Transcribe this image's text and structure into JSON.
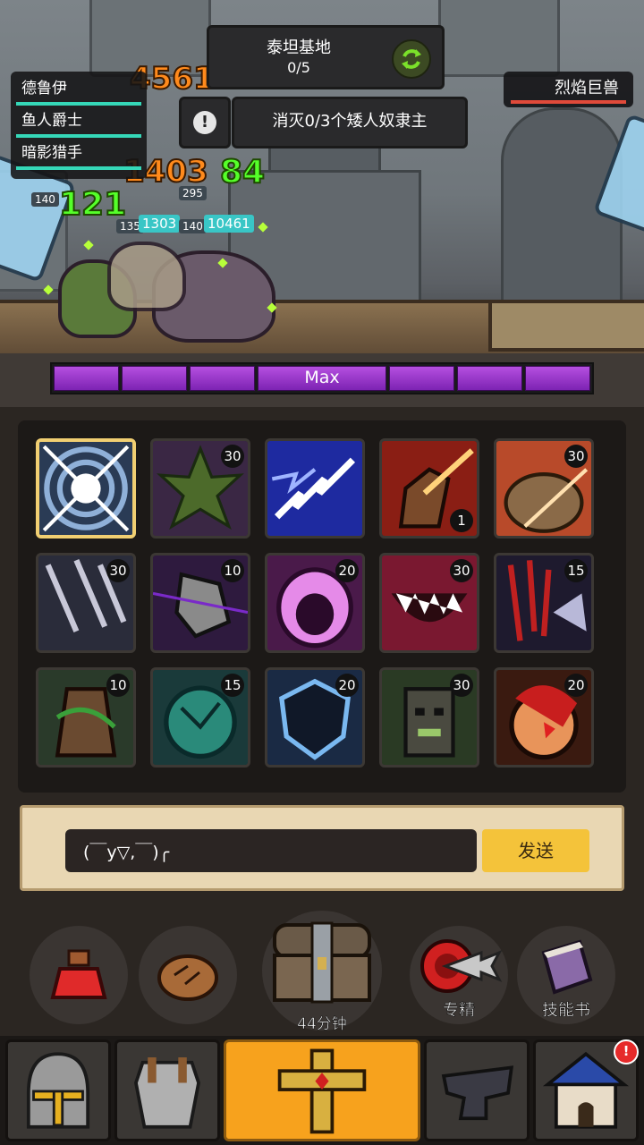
{
  "scene": {
    "quest": {
      "title": "泰坦基地",
      "progress": "0/5",
      "task": "消灭0/3个矮人奴隶主"
    },
    "heroes": [
      {
        "name": "德鲁伊"
      },
      {
        "name": "鱼人爵士"
      },
      {
        "name": "暗影猎手"
      }
    ],
    "boss": {
      "name": "烈焰巨兽"
    },
    "damage_numbers": [
      "4561",
      "1403",
      "84",
      "121"
    ],
    "damage_chips": [
      "140",
      "135",
      "1303",
      "295",
      "140",
      "10461"
    ],
    "icons": {
      "refresh": "refresh-icon",
      "alert": "exclamation-icon"
    },
    "colors": {
      "hero_health": "#35d8b8",
      "boss_health": "#e04a3a",
      "damage": "#ff8a1c",
      "heal": "#55ff2a"
    }
  },
  "rage_bar": {
    "label": "Max",
    "color": "#9b3fd0"
  },
  "skills": [
    {
      "icon": "radial-burst-icon",
      "badge": "",
      "selected": true
    },
    {
      "icon": "leaf-icon",
      "badge": "30"
    },
    {
      "icon": "lightning-icon",
      "badge": ""
    },
    {
      "icon": "beast-roar-icon",
      "badge": "1",
      "badge_pos": "bottom"
    },
    {
      "icon": "bear-slash-icon",
      "badge": "30"
    },
    {
      "icon": "arrow-volley-icon",
      "badge": "30"
    },
    {
      "icon": "shadow-claw-icon",
      "badge": "10"
    },
    {
      "icon": "pink-scream-icon",
      "badge": "20"
    },
    {
      "icon": "fang-maw-icon",
      "badge": "30"
    },
    {
      "icon": "bloody-claw-icon",
      "badge": "15"
    },
    {
      "icon": "vine-golem-icon",
      "badge": "10"
    },
    {
      "icon": "thorn-seed-icon",
      "badge": "15"
    },
    {
      "icon": "frost-shield-icon",
      "badge": "20"
    },
    {
      "icon": "stone-face-icon",
      "badge": "30"
    },
    {
      "icon": "fire-mask-icon",
      "badge": "20"
    }
  ],
  "chat": {
    "input_value": "(￣y▽,￣)╭",
    "send_label": "发送"
  },
  "actions": {
    "potion": {
      "icon": "potion-icon"
    },
    "bread": {
      "icon": "bread-icon"
    },
    "chest": {
      "icon": "treasure-chest-icon",
      "label": "44分钟"
    },
    "specialize": {
      "icon": "target-arrow-icon",
      "label": "专精"
    },
    "skillbook": {
      "icon": "book-icon",
      "label": "技能书"
    }
  },
  "nav": {
    "tabs": [
      {
        "icon": "helmet-icon"
      },
      {
        "icon": "armor-icon"
      },
      {
        "icon": "holy-cross-icon",
        "active": true
      },
      {
        "icon": "anvil-icon"
      },
      {
        "icon": "house-icon"
      }
    ],
    "notification": "!"
  }
}
